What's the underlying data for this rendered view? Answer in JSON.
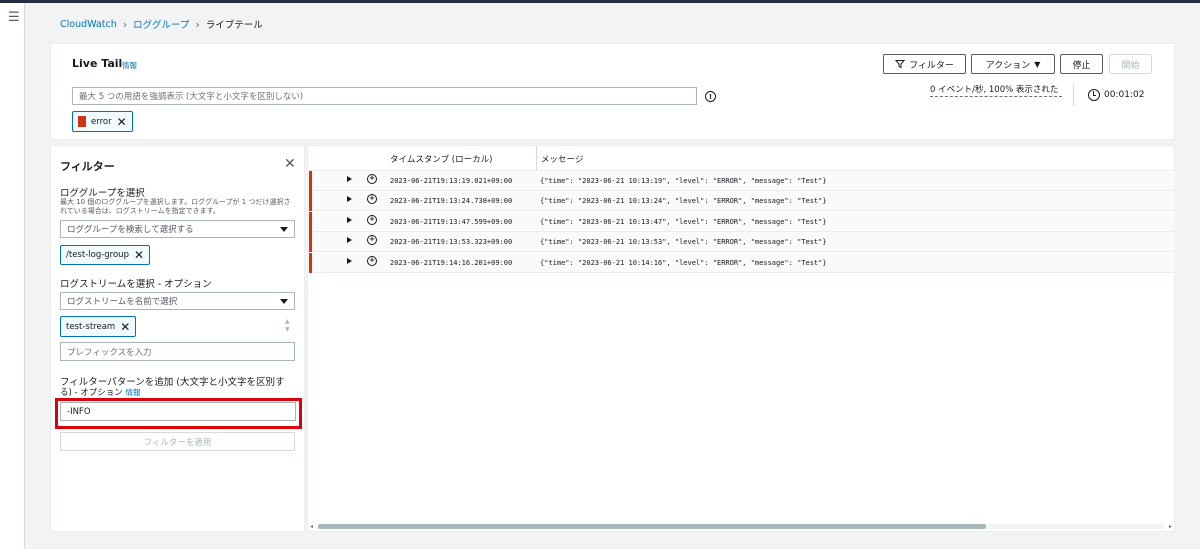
{
  "breadcrumb": {
    "root": "CloudWatch",
    "middle": "ロググループ",
    "current": "ライブテール"
  },
  "header": {
    "title": "Live Tail",
    "info_link": "情報",
    "filter_button": "フィルター",
    "actions_button": "アクション",
    "stop_button": "停止",
    "start_button": "開始"
  },
  "search": {
    "placeholder": "最大 5 つの用語を強調表示 (大文字と小文字を区別しない)"
  },
  "stats": {
    "rate": "0 イベント/秒, 100% 表示された",
    "elapsed": "00:01:02"
  },
  "highlight_token": {
    "label": "error",
    "color": "#d13212"
  },
  "filter_panel": {
    "title": "フィルター",
    "log_group_label": "ロググループを選択",
    "log_group_desc": "最大 10 個のロググループを選択します。ロググループが 1 つだけ選択されている場合は、ログストリームを指定できます。",
    "log_group_placeholder": "ロググループを検索して選択する",
    "log_group_token": "/test-log-group",
    "log_stream_label": "ログストリームを選択 - オプション",
    "log_stream_placeholder": "ログストリームを名前で選択",
    "log_stream_token": "test-stream",
    "prefix_placeholder": "プレフィックスを入力",
    "pattern_label_line1": "フィルターパターンを追加 (大文字と小文字を区別す",
    "pattern_label_line2": "る) - オプション",
    "pattern_info": "情報",
    "pattern_value": "-INFO",
    "apply_button": "フィルターを適用"
  },
  "log_table": {
    "columns": [
      "タイムスタンプ (ローカル)",
      "メッセージ"
    ],
    "rows": [
      {
        "timestamp": "2023-06-21T19:13:19.021+09:00",
        "message": "{\"time\": \"2023-06-21 10:13:19\", \"level\": \"ERROR\", \"message\": \"Test\"}"
      },
      {
        "timestamp": "2023-06-21T19:13:24.738+09:00",
        "message": "{\"time\": \"2023-06-21 10:13:24\", \"level\": \"ERROR\", \"message\": \"Test\"}"
      },
      {
        "timestamp": "2023-06-21T19:13:47.599+09:00",
        "message": "{\"time\": \"2023-06-21 10:13:47\", \"level\": \"ERROR\", \"message\": \"Test\"}"
      },
      {
        "timestamp": "2023-06-21T19:13:53.323+09:00",
        "message": "{\"time\": \"2023-06-21 10:13:53\", \"level\": \"ERROR\", \"message\": \"Test\"}"
      },
      {
        "timestamp": "2023-06-21T19:14:16.201+09:00",
        "message": "{\"time\": \"2023-06-21 10:14:16\", \"level\": \"ERROR\", \"message\": \"Test\"}"
      }
    ]
  },
  "icons": {
    "menu": "hamburger-icon",
    "filter": "funnel-icon",
    "dropdown": "caret-down-icon",
    "info": "info-circle-icon",
    "clock": "clock-icon",
    "close": "close-icon",
    "expand": "caret-right-icon",
    "zoom": "zoom-in-icon"
  }
}
